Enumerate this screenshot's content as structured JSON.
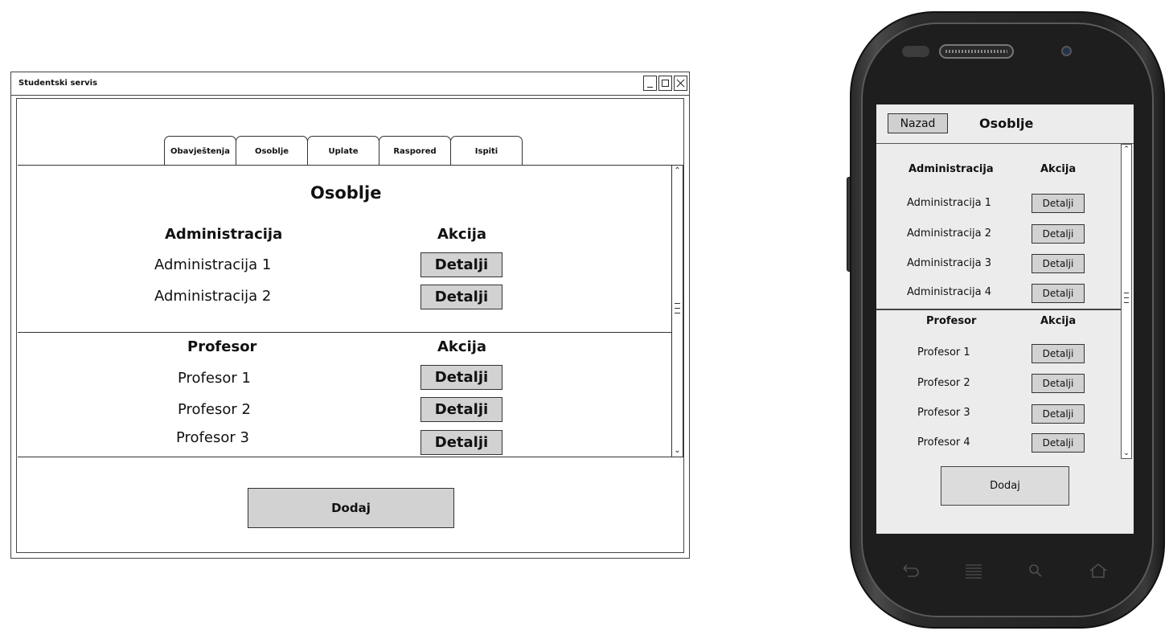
{
  "desktop": {
    "window_title": "Studentski servis",
    "tabs": [
      "Obavještenja",
      "Osoblje",
      "Uplate",
      "Raspored",
      "Ispiti"
    ],
    "page_title": "Osoblje",
    "administration": {
      "header": "Administracija",
      "action_header": "Akcija",
      "rows": [
        "Administracija 1",
        "Administracija 2"
      ]
    },
    "professors": {
      "header": "Profesor",
      "action_header": "Akcija",
      "rows": [
        "Profesor 1",
        "Profesor 2",
        "Profesor 3"
      ]
    },
    "details_label": "Detalji",
    "add_label": "Dodaj"
  },
  "mobile": {
    "back_label": "Nazad",
    "title": "Osoblje",
    "administration": {
      "header": "Administracija",
      "action_header": "Akcija",
      "rows": [
        "Administracija 1",
        "Administracija 2",
        "Administracija 3",
        "Administracija 4"
      ]
    },
    "professors": {
      "header": "Profesor",
      "action_header": "Akcija",
      "rows": [
        "Profesor 1",
        "Profesor 2",
        "Profesor 3",
        "Profesor 4"
      ]
    },
    "details_label": "Detalji",
    "add_label": "Dodaj",
    "nav_icons": [
      "back-icon",
      "menu-icon",
      "search-icon",
      "home-icon"
    ]
  },
  "colors": {
    "button_fill": "#d2d2d2",
    "screen_bg": "#ececec",
    "phone_body": "#222222"
  }
}
